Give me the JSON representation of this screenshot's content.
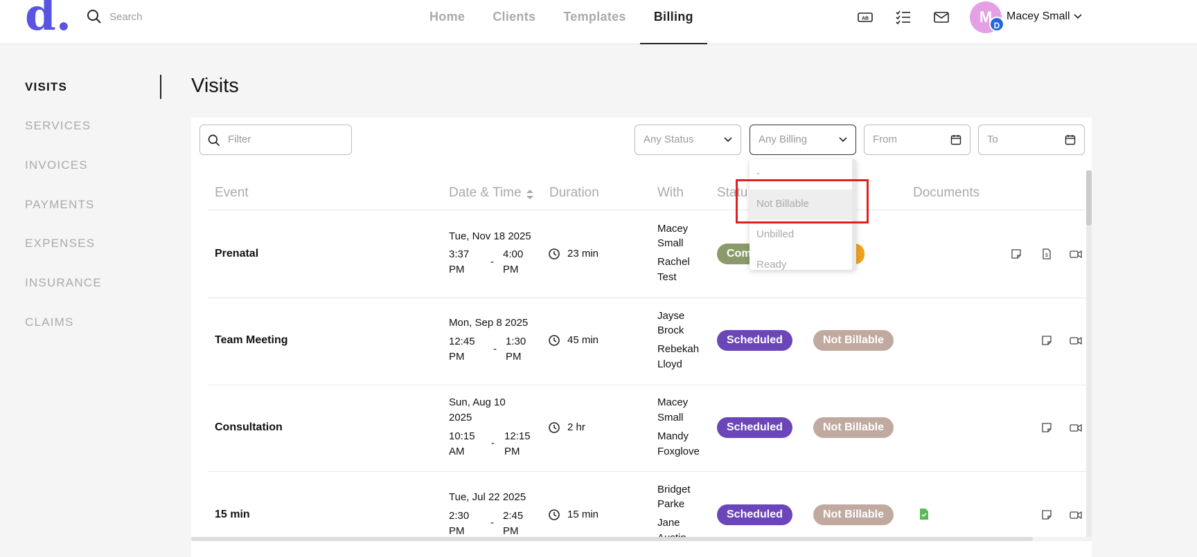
{
  "header": {
    "logo": "d.",
    "search_placeholder": "Search",
    "nav": [
      "Home",
      "Clients",
      "Templates",
      "Billing"
    ],
    "active_nav": "Billing",
    "icons": [
      "ab-badge-icon",
      "checklist-icon",
      "mail-icon"
    ],
    "user": {
      "initial": "M",
      "badge": "D",
      "name": "Macey Small"
    }
  },
  "sidebar": {
    "items": [
      "VISITS",
      "SERVICES",
      "INVOICES",
      "PAYMENTS",
      "EXPENSES",
      "INSURANCE",
      "CLAIMS"
    ],
    "active": "VISITS"
  },
  "main": {
    "title": "Visits",
    "filter_placeholder": "Filter",
    "status_filter": "Any Status",
    "billing_filter": "Any Billing",
    "from_placeholder": "From",
    "to_placeholder": "To",
    "billing_options": [
      "-",
      "Not Billable",
      "Unbilled",
      "Ready"
    ],
    "highlighted_option": "Not Billable",
    "columns": {
      "event": "Event",
      "date_time": "Date & Time",
      "duration": "Duration",
      "with": "With",
      "status": "Statu",
      "documents": "Documents"
    },
    "rows": [
      {
        "event": "Prenatal",
        "date": "Tue, Nov 18 2025",
        "start": [
          "3:37",
          "PM"
        ],
        "end": [
          "4:00",
          "PM"
        ],
        "duration": "23 min",
        "with": [
          [
            "Macey",
            "Small"
          ],
          [
            "Rachel",
            "Test"
          ]
        ],
        "status": "Com",
        "billing": ""
      },
      {
        "event": "Team Meeting",
        "date": "Mon, Sep 8 2025",
        "start": [
          "12:45",
          "PM"
        ],
        "end": [
          "1:30",
          "PM"
        ],
        "duration": "45 min",
        "with": [
          [
            "Jayse",
            "Brock"
          ],
          [
            "Rebekah",
            "Lloyd"
          ]
        ],
        "status": "Scheduled",
        "billing": "Not Billable"
      },
      {
        "event": "Consultation",
        "date": [
          "Sun, Aug 10",
          "2025"
        ],
        "start": [
          "10:15",
          "AM"
        ],
        "end": [
          "12:15",
          "PM"
        ],
        "duration": "2 hr",
        "with": [
          [
            "Macey",
            "Small"
          ],
          [
            "Mandy",
            "Foxglove"
          ]
        ],
        "status": "Scheduled",
        "billing": "Not Billable"
      },
      {
        "event": "15 min",
        "date": "Tue, Jul 22 2025",
        "start": [
          "2:30",
          "PM"
        ],
        "end": [
          "2:45",
          "PM"
        ],
        "duration": "15 min",
        "with": [
          [
            "Bridget",
            "Parke"
          ],
          [
            "Jane",
            "Austin"
          ]
        ],
        "status": "Scheduled",
        "billing": "Not Billable"
      }
    ],
    "dash": "-"
  },
  "colors": {
    "brand": "#5a55e0",
    "scheduled": "#6b46b8",
    "not_billable": "#c0aaa0",
    "completed": "#8a9a6a",
    "highlight": "#e02020"
  }
}
